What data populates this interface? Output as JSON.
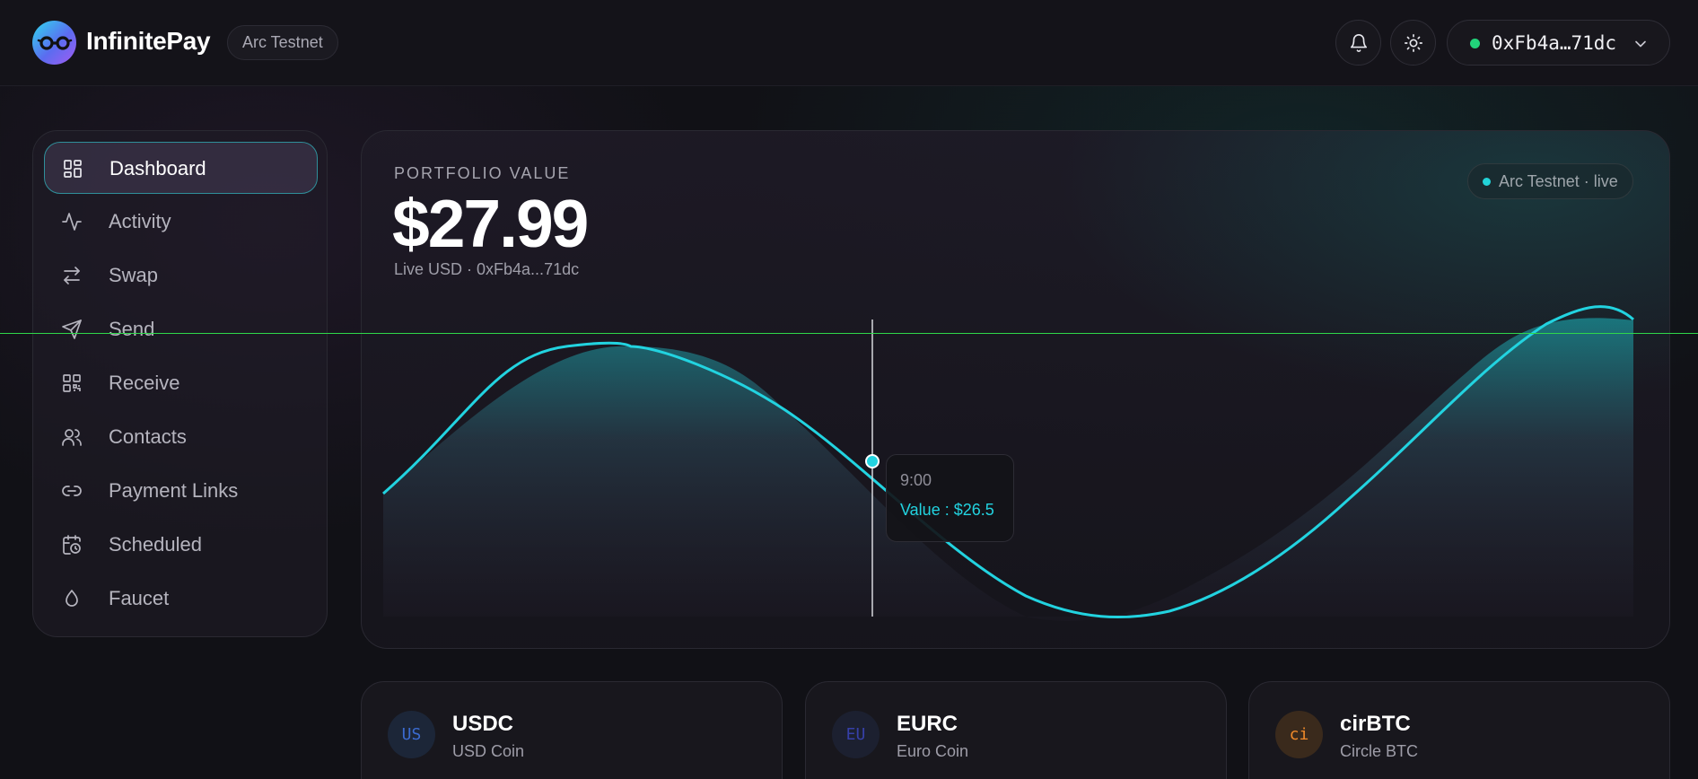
{
  "header": {
    "brand": "InfinitePay",
    "network_chip": "Arc Testnet",
    "wallet_address": "0xFb4a…71dc"
  },
  "sidebar": {
    "items": [
      {
        "label": "Dashboard",
        "icon": "grid-icon"
      },
      {
        "label": "Activity",
        "icon": "activity-icon"
      },
      {
        "label": "Swap",
        "icon": "swap-icon"
      },
      {
        "label": "Send",
        "icon": "send-icon"
      },
      {
        "label": "Receive",
        "icon": "qr-icon"
      },
      {
        "label": "Contacts",
        "icon": "contacts-icon"
      },
      {
        "label": "Payment Links",
        "icon": "link-icon"
      },
      {
        "label": "Scheduled",
        "icon": "calendar-clock-icon"
      },
      {
        "label": "Faucet",
        "icon": "droplet-icon"
      }
    ]
  },
  "portfolio": {
    "label": "PORTFOLIO VALUE",
    "value": "$27.99",
    "subtitle": "Live USD · 0xFb4a...71dc",
    "live_chip": "Arc Testnet · live"
  },
  "chart_data": {
    "type": "area",
    "line_color": "#22d3e0",
    "tooltip": {
      "time": "9:00",
      "value_text": "Value : $26.5"
    }
  },
  "tokens": [
    {
      "badge": "US",
      "symbol": "USDC",
      "name": "USD Coin",
      "badge_color": "#3b6bd0",
      "badge_bg": "#1c2638"
    },
    {
      "badge": "EU",
      "symbol": "EURC",
      "name": "Euro Coin",
      "badge_color": "#3640a8",
      "badge_bg": "#1c2030"
    },
    {
      "badge": "ci",
      "symbol": "cirBTC",
      "name": "Circle BTC",
      "badge_color": "#f08a2a",
      "badge_bg": "#3a2a1c"
    }
  ],
  "colors": {
    "accent": "#22d3e0",
    "live_dot": "#22d37a"
  }
}
